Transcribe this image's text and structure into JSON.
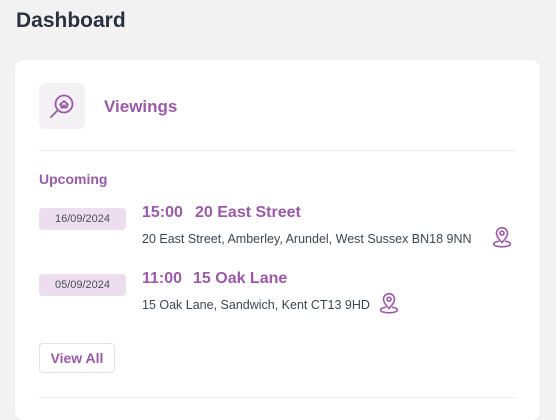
{
  "page": {
    "title": "Dashboard"
  },
  "card": {
    "title": "Viewings",
    "icon": "house-search-icon",
    "section_label": "Upcoming",
    "viewings": [
      {
        "date": "16/09/2024",
        "time": "15:00",
        "street": "20 East Street",
        "address": "20 East Street, Amberley, Arundel, West Sussex BN18 9NN",
        "icon": "map-pin-icon"
      },
      {
        "date": "05/09/2024",
        "time": "11:00",
        "street": "15 Oak Lane",
        "address": "15 Oak Lane, Sandwich, Kent CT13 9HD",
        "icon": "map-pin-icon"
      }
    ],
    "view_all_label": "View All"
  },
  "colors": {
    "accent": "#9b5aa6",
    "badge_bg": "#ecdeef",
    "page_bg": "#f2f2f2"
  }
}
